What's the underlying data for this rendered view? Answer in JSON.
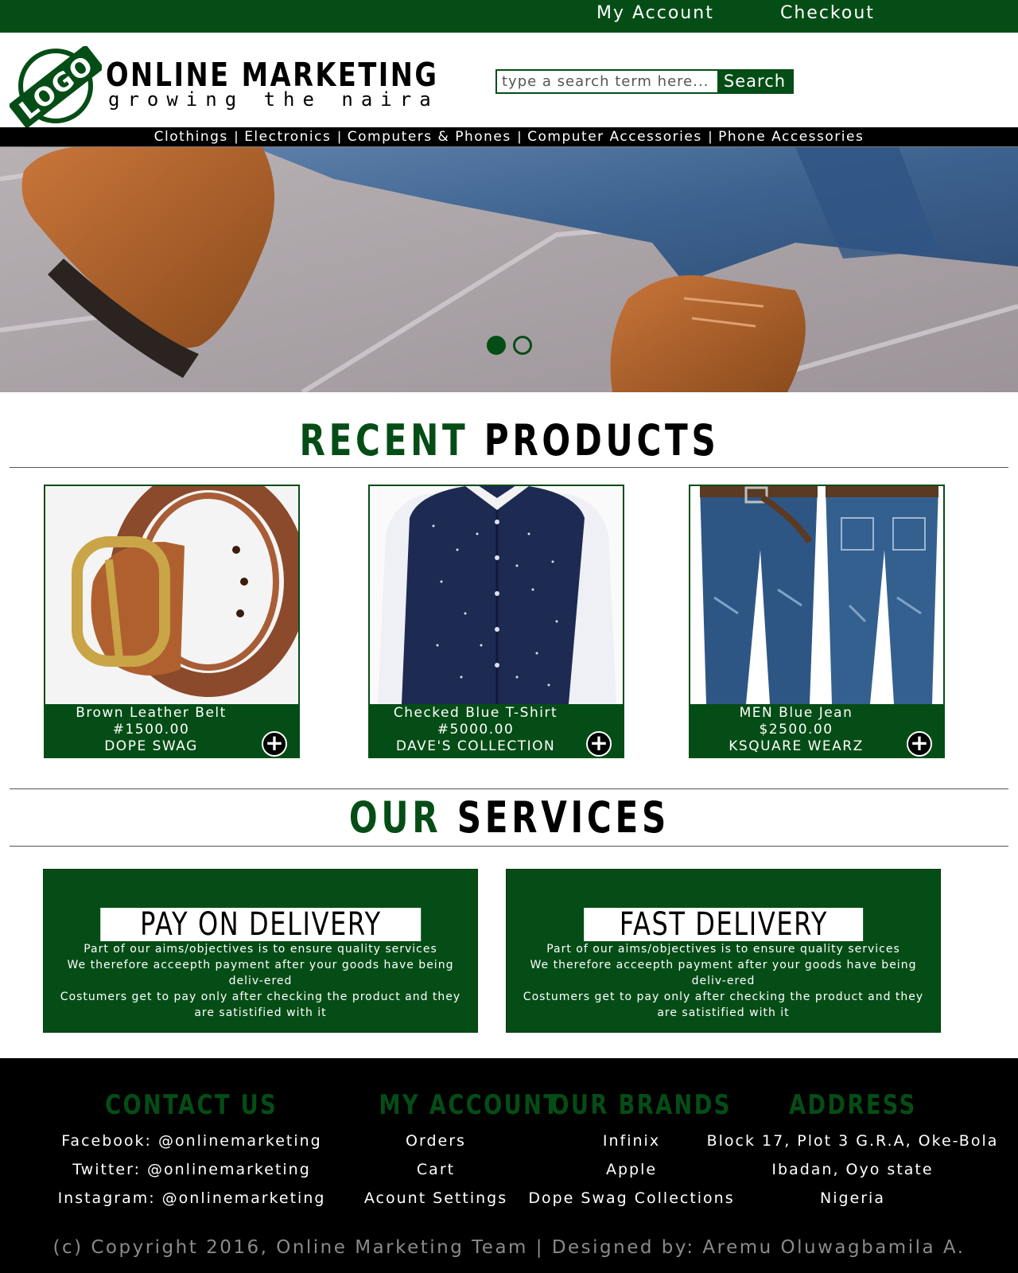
{
  "topbar": {
    "my_account": "My Account",
    "checkout": "Checkout"
  },
  "header": {
    "logo_text": "LOGO",
    "brand_title": "ONLINE MARKETING",
    "brand_tagline": "growing the naira"
  },
  "search": {
    "placeholder": "type a search term here...",
    "button_label": "Search"
  },
  "nav": {
    "items": [
      {
        "label": "Clothings"
      },
      {
        "label": "Electronics"
      },
      {
        "label": "Computers & Phones"
      },
      {
        "label": "Computer Accessories"
      },
      {
        "label": "Phone Accessories"
      }
    ],
    "separator": "|"
  },
  "hero": {
    "slides": 2,
    "active_slide": 1
  },
  "recent_products": {
    "heading_accent": "RECENT",
    "heading_rest": "PRODUCTS",
    "items": [
      {
        "name": "Brown Leather Belt",
        "price": "#1500.00",
        "store": "DOPE SWAG",
        "add_icon": "plus-icon"
      },
      {
        "name": "Checked Blue T-Shirt",
        "price": "#5000.00",
        "store": "DAVE'S COLLECTION",
        "add_icon": "plus-icon"
      },
      {
        "name": "MEN Blue Jean",
        "price": "$2500.00",
        "store": "KSQUARE WEARZ",
        "add_icon": "plus-icon"
      }
    ]
  },
  "services": {
    "heading_accent": "OUR",
    "heading_rest": "SERVICES",
    "items": [
      {
        "title": "PAY ON DELIVERY",
        "line1": "Part of our aims/objectives is to ensure quality services",
        "line2": "We therefore acceepth payment after your goods have being deliv-ered",
        "line3": "Costumers get to pay only after checking the product and they are satistified with it"
      },
      {
        "title": "FAST DELIVERY",
        "line1": "Part of our aims/objectives is to ensure quality services",
        "line2": "We therefore acceepth payment after your goods have being deliv-ered",
        "line3": "Costumers get to pay only after checking the product and they are satistified with it"
      }
    ]
  },
  "footer": {
    "contact": {
      "heading": "CONTACT US",
      "items": [
        "Facebook: @onlinemarketing",
        "Twitter: @onlinemarketing",
        "Instagram: @onlinemarketing"
      ]
    },
    "account": {
      "heading": "MY ACCOUNT",
      "items": [
        "Orders",
        "Cart",
        "Acount Settings"
      ]
    },
    "brands": {
      "heading": "OUR BRANDS",
      "items": [
        "Infinix",
        "Apple",
        "Dope Swag Collections"
      ]
    },
    "address": {
      "heading": "ADDRESS",
      "items": [
        "Block 17, Plot 3 G.R.A, Oke-Bola",
        "Ibadan, Oyo state",
        "Nigeria"
      ]
    },
    "copyright": "(c) Copyright 2016, Online Marketing Team | Designed by: Aremu Oluwagbamila A."
  },
  "colors": {
    "brand_green": "#054d16",
    "black": "#000000",
    "white": "#ffffff",
    "copyright_gray": "#8a8a8a"
  }
}
